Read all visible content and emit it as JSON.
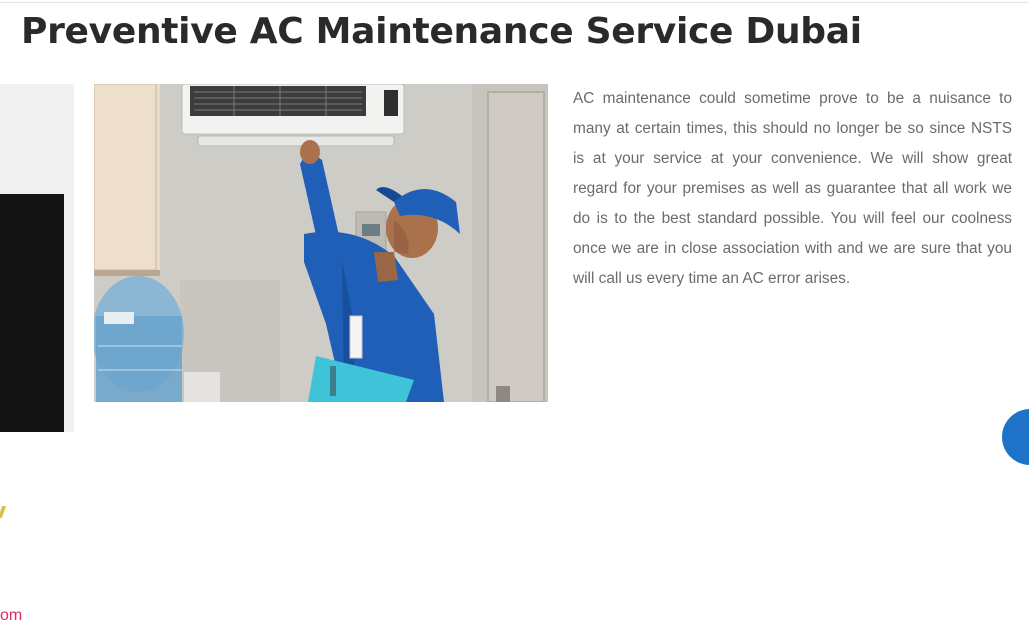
{
  "page": {
    "title": "Preventive AC Maintenance Service Dubai",
    "description": "AC maintenance could sometime prove to be a nuisance to many at certain times, this should no longer be so since NSTS is at your service at your convenience. We will show great regard for your premises as well as guarantee that all work we do is to the best standard possible. You will feel our coolness once we are in close association with and we are sure that you will call us every time an AC error arises."
  },
  "sidebar_card": {
    "partial_text": "om"
  },
  "photo": {
    "alt": "Technician in blue uniform inspecting a wall-mounted AC unit"
  },
  "colors": {
    "title": "#2a2a2a",
    "body_text": "#6b6b6b",
    "uniform_blue": "#1f5fb8",
    "card_accent": "#e0295c",
    "chat_button": "#1e72c8"
  },
  "icons": {
    "chat": "chat-bubble-icon"
  }
}
